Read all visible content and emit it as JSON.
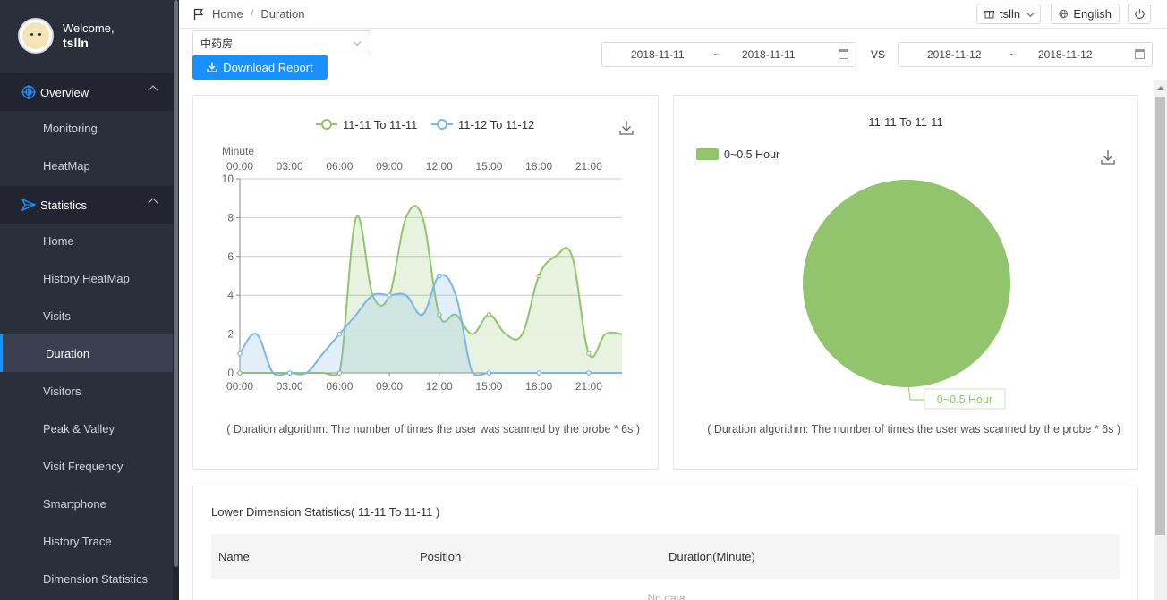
{
  "sidebar": {
    "welcome": "Welcome,",
    "username": "tslln",
    "groups": [
      {
        "label": "Overview",
        "icon": "target-icon"
      },
      {
        "label": "Statistics",
        "icon": "send-icon"
      }
    ],
    "overview_items": [
      "Monitoring",
      "HeatMap"
    ],
    "statistics_items": [
      "Home",
      "History HeatMap",
      "Visits",
      "Duration",
      "Visitors",
      "Peak & Valley",
      "Visit Frequency",
      "Smartphone",
      "History Trace",
      "Dimension Statistics"
    ],
    "active_item": "Duration"
  },
  "topbar": {
    "breadcrumb": [
      "Home",
      "Duration"
    ],
    "separator": "/",
    "user_button": "tslln",
    "language_button": "English"
  },
  "controls": {
    "store_select": "中药房",
    "download_label": "Download Report",
    "range1": {
      "start": "2018-11-11",
      "sep": "~",
      "end": "2018-11-11"
    },
    "vs": "VS",
    "range2": {
      "start": "2018-11-12",
      "sep": "~",
      "end": "2018-11-12"
    }
  },
  "line_card": {
    "note": "( Duration algorithm: The number of times the user was scanned by the probe * 6s )"
  },
  "pie_card": {
    "note": "( Duration algorithm: The number of times the user was scanned by the probe * 6s )"
  },
  "table": {
    "title": "Lower Dimension Statistics( 11-11 To 11-11 )",
    "columns": [
      "Name",
      "Position",
      "Duration(Minute)"
    ],
    "empty_text": "No data"
  },
  "colors": {
    "series1": "#91c46c",
    "series2": "#7cb5ec",
    "accent": "#1890ff"
  },
  "chart_data": [
    {
      "type": "area",
      "title": "",
      "ylabel": "Minute",
      "xlabel": "",
      "x_ticks": [
        "00:00",
        "03:00",
        "06:00",
        "09:00",
        "12:00",
        "15:00",
        "18:00",
        "21:00"
      ],
      "x_range": [
        0,
        23
      ],
      "ylim": [
        0,
        10
      ],
      "y_ticks": [
        0,
        2,
        4,
        6,
        8,
        10
      ],
      "grid": true,
      "legend": "top",
      "series": [
        {
          "name": "11-11 To 11-11",
          "color": "#91c46c",
          "x": [
            0,
            1,
            2,
            3,
            4,
            5,
            6,
            7,
            8,
            9,
            10,
            11,
            12,
            13,
            14,
            15,
            16,
            17,
            18,
            19,
            20,
            21,
            22,
            23
          ],
          "values": [
            0,
            0,
            0,
            0,
            0,
            0,
            0,
            8,
            4,
            4,
            8,
            8,
            3,
            3,
            2,
            3,
            2,
            2,
            5,
            6,
            6,
            1,
            2,
            2
          ]
        },
        {
          "name": "11-12 To 11-12",
          "color": "#7cb5ec",
          "x": [
            0,
            1,
            2,
            3,
            4,
            5,
            6,
            7,
            8,
            9,
            10,
            11,
            12,
            13,
            14,
            15,
            16,
            17,
            18,
            19,
            20,
            21,
            22,
            23
          ],
          "values": [
            1,
            2,
            0,
            0,
            0,
            1,
            2,
            3,
            4,
            4,
            4,
            3,
            5,
            4,
            0,
            0,
            0,
            0,
            0,
            0,
            0,
            0,
            0,
            0
          ]
        }
      ]
    },
    {
      "type": "pie",
      "title": "11-11 To 11-11",
      "legend": "top-left",
      "slices": [
        {
          "label": "0~0.5 Hour",
          "value": 100,
          "color": "#91c46c"
        }
      ],
      "labels": [
        "0~0.5 Hour"
      ]
    }
  ]
}
